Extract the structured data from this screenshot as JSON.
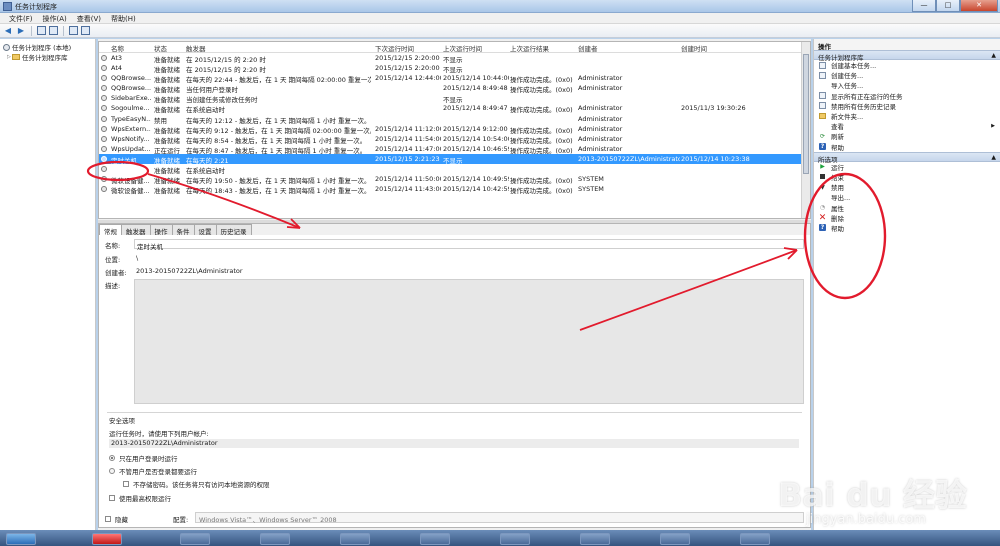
{
  "window": {
    "title": "任务计划程序",
    "minimize": "—",
    "maximize": "□",
    "close": "✕"
  },
  "menu": [
    "文件(F)",
    "操作(A)",
    "查看(V)",
    "帮助(H)"
  ],
  "tree": {
    "root": "任务计划程序 (本地)",
    "library": "任务计划程序库"
  },
  "grid": {
    "columns": [
      "名称",
      "状态",
      "触发器",
      "下次运行时间",
      "上次运行时间",
      "上次运行结果",
      "创建者",
      "创建时间"
    ],
    "rows": [
      [
        "At3",
        "准备就绪",
        "在 2015/12/15 的 2:20 时",
        "2015/12/15 2:20:00",
        "不显示",
        "",
        "",
        ""
      ],
      [
        "At4",
        "准备就绪",
        "在 2015/12/15 的 2:20 时",
        "2015/12/15 2:20:00",
        "不显示",
        "",
        "",
        ""
      ],
      [
        "QQBrowse...",
        "准备就绪",
        "在每天的 22:44 - 触发后，在 1 天 期间每隔 02:00:00 重复一次。",
        "2015/12/14 12:44:00",
        "2015/12/14 10:44:00",
        "操作成功完成。(0x0)",
        "Administrator",
        ""
      ],
      [
        "QQBrowse...",
        "准备就绪",
        "当任何用户登录时",
        "",
        "2015/12/14 8:49:48",
        "操作成功完成。(0x0)",
        "Administrator",
        ""
      ],
      [
        "SidebarExe...",
        "准备就绪",
        "当创建任务或修改任务时",
        "",
        "不显示",
        "",
        "",
        ""
      ],
      [
        "Sogoulme...",
        "准备就绪",
        "在系统启动时",
        "",
        "2015/12/14 8:49:47",
        "操作成功完成。(0x0)",
        "Administrator",
        "2015/11/3 19:30:26"
      ],
      [
        "TypeEasyN...",
        "禁用",
        "在每天的 12:12 - 触发后，在 1 天 期间每隔 1 小时 重复一次。",
        "",
        "",
        "",
        "Administrator",
        ""
      ],
      [
        "WpsExtern...",
        "准备就绪",
        "在每天的 9:12 - 触发后，在 1 天 期间每隔 02:00:00 重复一次。",
        "2015/12/14 11:12:00",
        "2015/12/14 9:12:00",
        "操作成功完成。(0x0)",
        "Administrator",
        ""
      ],
      [
        "WpsNotify...",
        "准备就绪",
        "在每天的 8:54 - 触发后，在 1 天 期间每隔 1 小时 重复一次。",
        "2015/12/14 11:54:00",
        "2015/12/14 10:54:00",
        "操作成功完成。(0x0)",
        "Administrator",
        ""
      ],
      [
        "WpsUpdat...",
        "正在运行",
        "在每天的 8:47 - 触发后，在 1 天 期间每隔 1 小时 重复一次。",
        "2015/12/14 11:47:00",
        "2015/12/14 10:46:59",
        "操作成功完成。(0x0)",
        "Administrator",
        ""
      ],
      [
        "定时关机",
        "准备就绪",
        "在每天的 2:21",
        "2015/12/15 2:21:23",
        "不显示",
        "",
        "2013-20150722ZL\\Administrator",
        "2015/12/14 10:23:38"
      ],
      [
        "",
        "准备就绪",
        "在系统启动时",
        "",
        "",
        "",
        "",
        ""
      ],
      [
        "微软设备健...",
        "准备就绪",
        "在每天的 19:50 - 触发后，在 1 天 期间每隔 1 小时 重复一次。",
        "2015/12/14 11:50:00",
        "2015/12/14 10:49:59",
        "操作成功完成。(0x0)",
        "SYSTEM",
        ""
      ],
      [
        "微软设备健...",
        "准备就绪",
        "在每天的 18:43 - 触发后，在 1 天 期间每隔 1 小时 重复一次。",
        "2015/12/14 11:43:00",
        "2015/12/14 10:42:59",
        "操作成功完成。(0x0)",
        "SYSTEM",
        ""
      ]
    ],
    "selected_index": 10
  },
  "detail": {
    "tabs": [
      "常规",
      "触发器",
      "操作",
      "条件",
      "设置",
      "历史记录"
    ],
    "active_tab": 0,
    "name_label": "名称:",
    "name_value": "定时关机",
    "location_label": "位置:",
    "location_value": "\\",
    "author_label": "创建者:",
    "author_value": "2013-20150722ZL\\Administrator",
    "desc_label": "描述:",
    "security_title": "安全选项",
    "run_as_label": "运行任务时，请使用下列用户帐户:",
    "run_as_value": "2013-20150722ZL\\Administrator",
    "opt_logged_on": "只在用户登录时运行",
    "opt_any": "不管用户是否登录都要运行",
    "opt_no_password": "不存储密码。该任务将只有访问本地资源的权限",
    "opt_highest": "使用最高权限运行",
    "hidden_label": "隐藏",
    "config_label": "配置:",
    "config_value": "Windows Vista™、Windows Server™ 2008"
  },
  "actions": {
    "title": "操作",
    "section1": "任务计划程序库",
    "items1": [
      "创建基本任务...",
      "创建任务...",
      "导入任务...",
      "显示所有正在运行的任务",
      "禁用所有任务历史记录",
      "新文件夹...",
      "查看",
      "刷新",
      "帮助"
    ],
    "section2": "所选项",
    "items2": [
      "运行",
      "结束",
      "禁用",
      "导出...",
      "属性",
      "删除",
      "帮助"
    ]
  },
  "watermark": {
    "logo": "Bai du 经验",
    "url": "jingyan.baidu.com"
  },
  "colors": {
    "selection": "#3399ff",
    "annotation": "#e21b2d",
    "titlebar": "#a9c6e8"
  },
  "icons": {
    "back": "back-arrow-icon",
    "forward": "forward-arrow-icon",
    "run": "play-icon",
    "delete": "red-x-icon"
  }
}
